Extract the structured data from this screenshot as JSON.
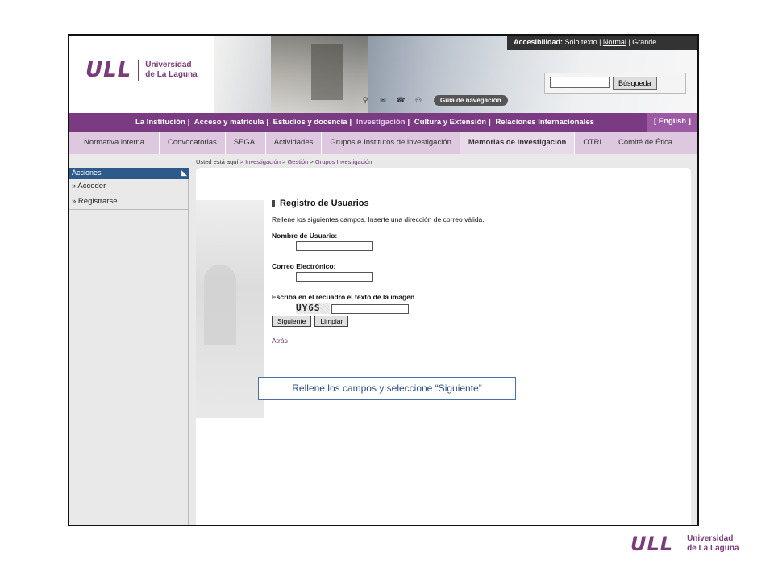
{
  "header": {
    "logo_mark": "ULL",
    "logo_line1": "Universidad",
    "logo_line2": "de La Laguna",
    "accessibility_label": "Accesibilidad:",
    "access_text_only": "Sólo texto",
    "access_normal": "Normal",
    "access_large": "Grande",
    "search_button": "Búsqueda",
    "search_value": "",
    "guide_label": "Guía de navegación"
  },
  "main_nav": {
    "items": [
      "La Institución",
      "Acceso y matrícula",
      "Estudios y docencia",
      "Investigación",
      "Cultura y Extensión",
      "Relaciones Internacionales"
    ],
    "english": "[ English ]"
  },
  "sub_nav": {
    "items": [
      "Normativa interna",
      "Convocatorias",
      "SEGAI",
      "Actividades",
      "Grupos e Institutos de investigación",
      "Memorias de investigación",
      "OTRI",
      "Comité de Ética"
    ]
  },
  "breadcrumb": {
    "prefix": "Usted está aquí >",
    "crumbs": [
      "Investigación",
      "Gestión",
      "Grupos Investigación"
    ]
  },
  "sidebar": {
    "title": "Acciones",
    "items": [
      "» Acceder",
      "» Registrarse"
    ]
  },
  "form": {
    "title": "Registro de Usuarios",
    "intro": "Rellene los siguientes campos. Inserte una dirección de correo válida.",
    "username_label": "Nombre de Usuario:",
    "email_label": "Correo Electrónico:",
    "captcha_label": "Escriba en el recuadro el texto de la imagen",
    "captcha_text": "UY6S",
    "next_button": "Siguiente",
    "clear_button": "Limpiar",
    "back_link": "Atrás"
  },
  "annotation": {
    "text": "Rellene  los campos y seleccione “Siguiente”"
  },
  "colors": {
    "brand_purple": "#7b3b82",
    "subnav_bg": "#ddc8df",
    "sidebar_header": "#2c5a8a"
  }
}
